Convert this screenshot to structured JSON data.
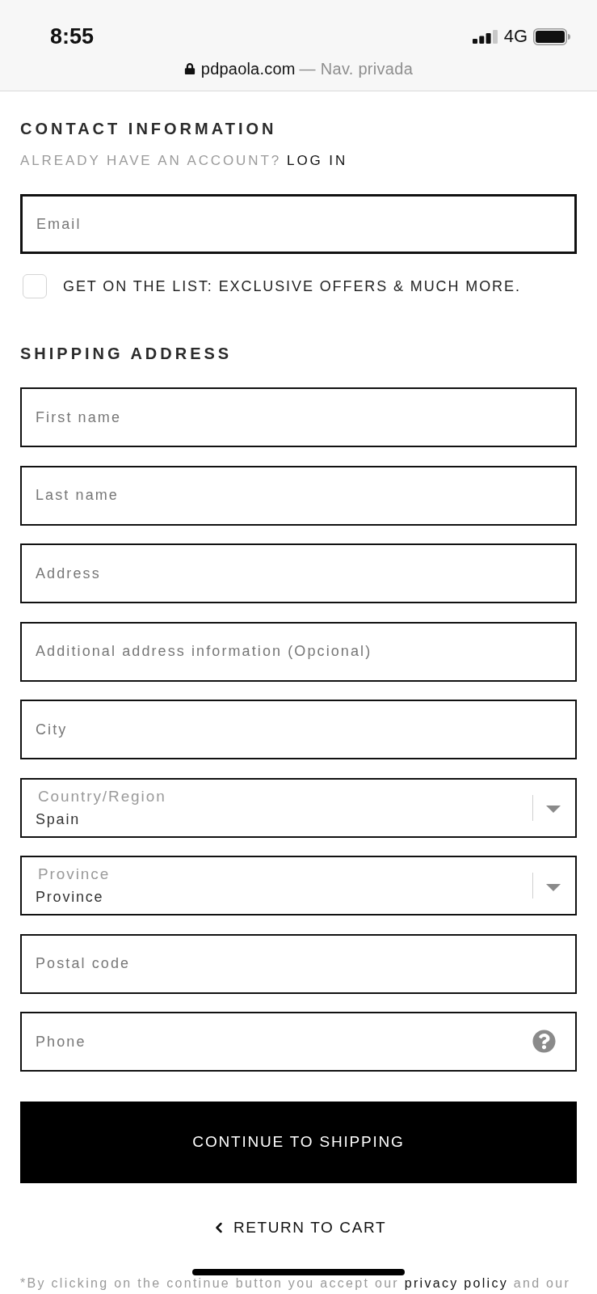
{
  "status_bar": {
    "time": "8:55",
    "network": "4G"
  },
  "address_bar": {
    "domain": "pdpaola.com",
    "mode": "— Nav. privada"
  },
  "contact": {
    "title": "CONTACT INFORMATION",
    "account_prompt": "ALREADY HAVE AN ACCOUNT?",
    "login_link": "LOG IN",
    "email": {
      "placeholder": "Email",
      "focused": true
    },
    "newsletter": {
      "label": "GET ON THE LIST: EXCLUSIVE OFFERS & MUCH MORE.",
      "checked": false
    }
  },
  "shipping": {
    "title": "SHIPPING ADDRESS",
    "fields": [
      {
        "kind": "text",
        "placeholder": "First name"
      },
      {
        "kind": "text",
        "placeholder": "Last name"
      },
      {
        "kind": "text",
        "placeholder": "Address"
      },
      {
        "kind": "text",
        "placeholder": "Additional address information (Opcional)"
      },
      {
        "kind": "text",
        "placeholder": "City"
      },
      {
        "kind": "select",
        "label": "Country/Region",
        "value": "Spain"
      },
      {
        "kind": "select",
        "label": "Province",
        "value": "Province"
      },
      {
        "kind": "text",
        "placeholder": "Postal code"
      },
      {
        "kind": "phone",
        "placeholder": "Phone"
      }
    ]
  },
  "continue_button": "CONTINUE TO SHIPPING",
  "return_link": "RETURN TO CART",
  "legal_note": {
    "text_before": "*By clicking on the continue button you accept our",
    "link": "privacy policy",
    "text_after": "and our"
  }
}
